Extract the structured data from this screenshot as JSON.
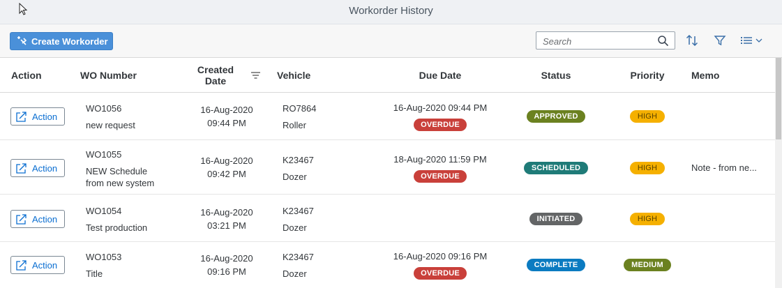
{
  "window": {
    "title": "Workorder History"
  },
  "toolbar": {
    "create_label": "Create Workorder",
    "search_placeholder": "Search"
  },
  "columns": {
    "action": "Action",
    "wo_number": "WO Number",
    "created_line1": "Created",
    "created_line2": "Date",
    "vehicle": "Vehicle",
    "due_date": "Due Date",
    "status": "Status",
    "priority": "Priority",
    "memo": "Memo"
  },
  "rows": [
    {
      "action": "Action",
      "wo": "WO1056",
      "desc1": "new request",
      "desc2": "",
      "created_date": "16-Aug-2020",
      "created_time": "09:44 PM",
      "vehicle_id": "RO7864",
      "vehicle_type": "Roller",
      "due": "16-Aug-2020 09:44 PM",
      "overdue": "OVERDUE",
      "status": "APPROVED",
      "priority": "HIGH",
      "memo": ""
    },
    {
      "action": "Action",
      "wo": "WO1055",
      "desc1": "NEW Schedule",
      "desc2": "from new system",
      "created_date": "16-Aug-2020",
      "created_time": "09:42 PM",
      "vehicle_id": "K23467",
      "vehicle_type": "Dozer",
      "due": "18-Aug-2020 11:59 PM",
      "overdue": "OVERDUE",
      "status": "SCHEDULED",
      "priority": "HIGH",
      "memo": "Note - from ne..."
    },
    {
      "action": "Action",
      "wo": "WO1054",
      "desc1": "Test production",
      "desc2": "",
      "created_date": "16-Aug-2020",
      "created_time": "03:21 PM",
      "vehicle_id": "K23467",
      "vehicle_type": "Dozer",
      "due": "",
      "overdue": "",
      "status": "INITIATED",
      "priority": "HIGH",
      "memo": ""
    },
    {
      "action": "Action",
      "wo": "WO1053",
      "desc1": "Title",
      "desc2": "",
      "created_date": "16-Aug-2020",
      "created_time": "09:16 PM",
      "vehicle_id": "K23467",
      "vehicle_type": "Dozer",
      "due": "16-Aug-2020 09:16 PM",
      "overdue": "OVERDUE",
      "status": "COMPLETE",
      "priority": "MEDIUM",
      "memo": ""
    }
  ],
  "icons": {
    "create": "create-workorder-icon",
    "search": "search-icon",
    "sort": "sort-icon",
    "filter": "filter-icon",
    "view": "list-view-icon",
    "action": "open-external-icon"
  },
  "colors": {
    "accent": "#4a90d9",
    "link": "#0a6ed1",
    "overdue": "#c9403a",
    "approved": "#6b8120",
    "scheduled": "#1f7b78",
    "initiated": "#636566",
    "complete": "#0b7bc1",
    "high": "#f5b000",
    "medium": "#6b8120"
  }
}
